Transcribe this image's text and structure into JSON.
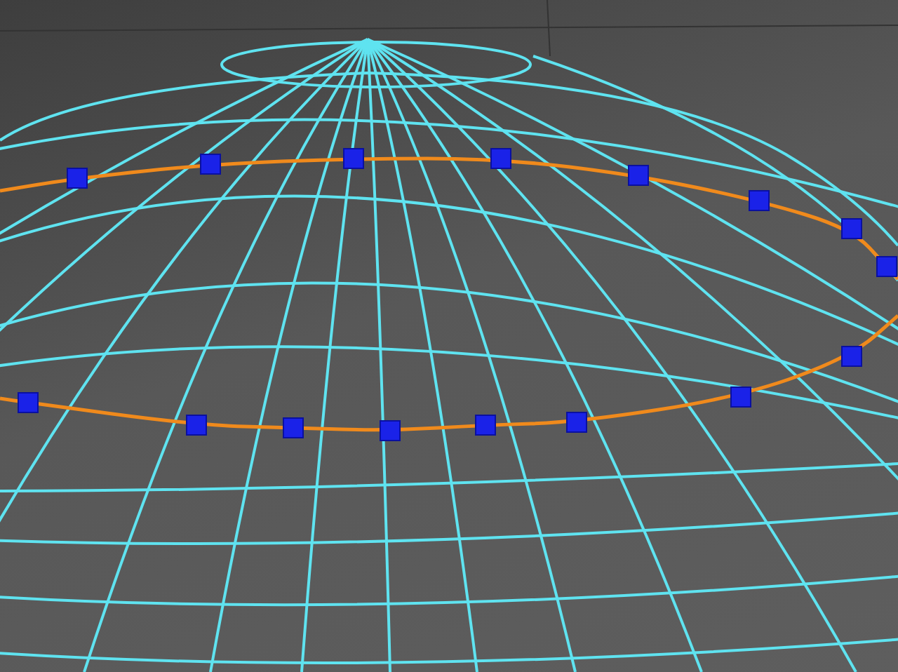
{
  "viewport": {
    "loops": [
      {
        "selected": true
      },
      {
        "selected": true
      }
    ]
  }
}
